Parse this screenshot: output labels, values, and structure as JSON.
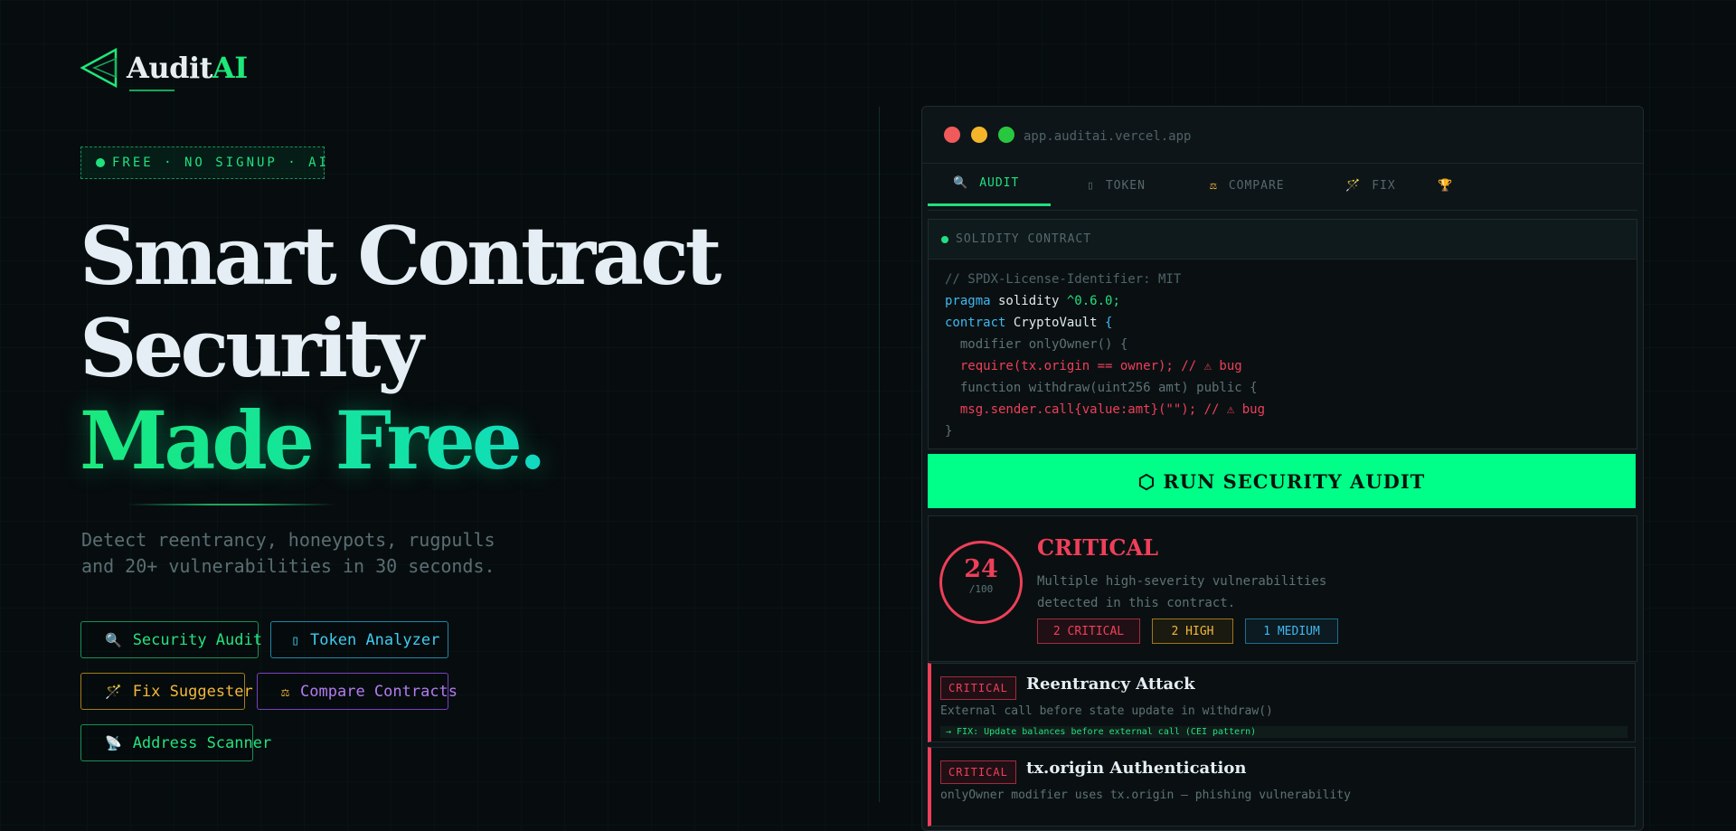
{
  "logo": {
    "name_main": "Audit",
    "name_accent": "AI"
  },
  "badge": {
    "text": "FREE · NO SIGNUP · AI"
  },
  "hero": {
    "line1": "Smart Contract",
    "line2": "Security",
    "line3": "Made Free."
  },
  "subtitle": {
    "line1": "Detect reentrancy, honeypots, rugpulls",
    "line2": "and 20+ vulnerabilities in 30 seconds."
  },
  "features": [
    {
      "icon": "🔍",
      "label": "Security Audit"
    },
    {
      "icon": "▯",
      "label": "Token Analyzer"
    },
    {
      "icon": "🪄",
      "label": "Fix Suggester"
    },
    {
      "icon": "⚖",
      "label": "Compare Contracts"
    },
    {
      "icon": "📡",
      "label": "Address Scanner"
    }
  ],
  "window": {
    "url": "app.auditai.vercel.app",
    "tabs": [
      {
        "icon": "🔍",
        "label": "AUDIT"
      },
      {
        "icon": "▯",
        "label": "TOKEN"
      },
      {
        "icon": "⚖",
        "label": "COMPARE"
      },
      {
        "icon": "🪄",
        "label": "FIX"
      },
      {
        "icon": "🏆",
        "label": ""
      }
    ],
    "editor_title": "SOLIDITY CONTRACT",
    "code": {
      "l1": "// SPDX-License-Identifier: MIT",
      "l2_kw": "pragma",
      "l2_nm": " solidity ",
      "l2_ver": "^0.6.0;",
      "l3_kw": "contract",
      "l3_nm": " CryptoVault ",
      "l3_br": "{",
      "l4": "  modifier onlyOwner() {",
      "l5": "  require(tx.origin == owner); // ⚠ bug",
      "l6": "  function withdraw(uint256 amt) public {",
      "l7": "  msg.sender.call{value:amt}(\"\"); // ⚠ bug",
      "l8": "}"
    },
    "run_button": "⬡ RUN SECURITY AUDIT",
    "result": {
      "score": "24",
      "score_max": "/100",
      "severity": "CRITICAL",
      "description": "Multiple high-severity vulnerabilities detected in this contract.",
      "counts": [
        "2 CRITICAL",
        "2 HIGH",
        "1 MEDIUM"
      ]
    },
    "issues": [
      {
        "tag": "CRITICAL",
        "title": "Reentrancy Attack",
        "desc": "External call before state update in withdraw()",
        "fix": "→ FIX: Update balances before external call (CEI pattern)"
      },
      {
        "tag": "CRITICAL",
        "title": "tx.origin Authentication",
        "desc": "onlyOwner modifier uses tx.origin — phishing vulnerability"
      }
    ]
  },
  "colors": {
    "accent": "#00ff88",
    "critical": "#ef3f59",
    "high": "#f2b73a",
    "medium": "#3fb8f0",
    "background": "#070d0f"
  }
}
